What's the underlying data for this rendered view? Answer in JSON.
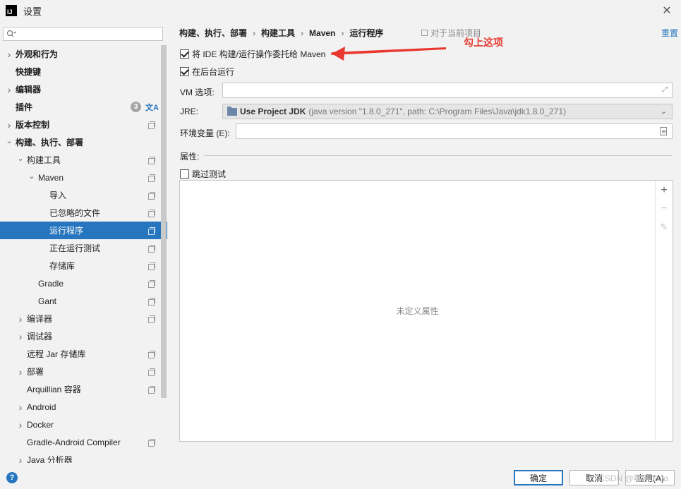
{
  "window": {
    "title": "设置",
    "logo_text": "IJ"
  },
  "search": {
    "placeholder": ""
  },
  "tree": [
    {
      "label": "外观和行为",
      "indent": 0,
      "chevron": "right",
      "bold": true
    },
    {
      "label": "快捷键",
      "indent": 0,
      "chevron": "",
      "bold": true
    },
    {
      "label": "编辑器",
      "indent": 0,
      "chevron": "right",
      "bold": true
    },
    {
      "label": "插件",
      "indent": 0,
      "chevron": "",
      "bold": true,
      "badge": "3",
      "translate_icon": "文A"
    },
    {
      "label": "版本控制",
      "indent": 0,
      "chevron": "right",
      "bold": true,
      "proj": true
    },
    {
      "label": "构建、执行、部署",
      "indent": 0,
      "chevron": "down",
      "bold": true
    },
    {
      "label": "构建工具",
      "indent": 1,
      "chevron": "down",
      "proj": true
    },
    {
      "label": "Maven",
      "indent": 2,
      "chevron": "down",
      "proj": true
    },
    {
      "label": "导入",
      "indent": 3,
      "chevron": "",
      "proj": true
    },
    {
      "label": "已忽略的文件",
      "indent": 3,
      "chevron": "",
      "proj": true
    },
    {
      "label": "运行程序",
      "indent": 3,
      "chevron": "",
      "proj": true,
      "selected": true
    },
    {
      "label": "正在运行测试",
      "indent": 3,
      "chevron": "",
      "proj": true
    },
    {
      "label": "存储库",
      "indent": 3,
      "chevron": "",
      "proj": true
    },
    {
      "label": "Gradle",
      "indent": 2,
      "chevron": "",
      "proj": true
    },
    {
      "label": "Gant",
      "indent": 2,
      "chevron": "",
      "proj": true
    },
    {
      "label": "编译器",
      "indent": 1,
      "chevron": "right",
      "proj": true
    },
    {
      "label": "调试器",
      "indent": 1,
      "chevron": "right"
    },
    {
      "label": "远程 Jar 存储库",
      "indent": 1,
      "chevron": "",
      "proj": true
    },
    {
      "label": "部署",
      "indent": 1,
      "chevron": "right",
      "proj": true
    },
    {
      "label": "Arquillian 容器",
      "indent": 1,
      "chevron": "",
      "proj": true
    },
    {
      "label": "Android",
      "indent": 1,
      "chevron": "right"
    },
    {
      "label": "Docker",
      "indent": 1,
      "chevron": "right"
    },
    {
      "label": "Gradle-Android Compiler",
      "indent": 1,
      "chevron": "",
      "proj": true
    },
    {
      "label": "Java 分析器",
      "indent": 1,
      "chevron": "right"
    }
  ],
  "breadcrumb": [
    "构建、执行、部署",
    "构建工具",
    "Maven",
    "运行程序"
  ],
  "scope_note": "对于当前项目",
  "reset_label": "重置",
  "options": {
    "delegate_label": "将 IDE 构建/运行操作委托给 Maven",
    "delegate_checked": true,
    "background_label": "在后台运行",
    "background_checked": true
  },
  "vm_options": {
    "label": "VM 选项:",
    "value": ""
  },
  "jre": {
    "label": "JRE:",
    "main": "Use Project JDK",
    "detail": "(java version \"1.8.0_271\", path: C:\\Program Files\\Java\\jdk1.8.0_271)"
  },
  "env": {
    "label": "环境变量 (E):",
    "value": ""
  },
  "properties": {
    "label": "属性:",
    "skip_tests_label": "跳过测试",
    "skip_tests_checked": false,
    "empty_text": "未定义属性"
  },
  "annotation": {
    "text": "勾上这项",
    "color": "#e8382f"
  },
  "buttons": {
    "ok": "确定",
    "cancel": "取消",
    "apply": "应用(A)"
  },
  "help_label": "?",
  "watermark": "CSDN @咖啡Java",
  "colors": {
    "accent": "#2675bf",
    "selected_bg": "#2675bf"
  }
}
